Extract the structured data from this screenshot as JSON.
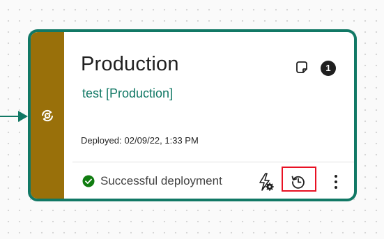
{
  "stage": {
    "title": "Production",
    "workspace": "test [Production]",
    "deployed_label": "Deployed:",
    "deployed_value": "02/09/22, 1:33 PM",
    "notification_count": "1"
  },
  "footer": {
    "status_text": "Successful deployment"
  },
  "icons": {
    "stage": "stage-swap-icon",
    "note": "note-icon",
    "status": "check-circle-icon",
    "rules": "deployment-rules-icon",
    "history": "deployment-history-icon",
    "more": "more-options-icon"
  },
  "colors": {
    "border": "#117865",
    "stage_bar": "#99700a",
    "workspace_link": "#117865",
    "success": "#107c10",
    "highlight": "#e81123",
    "badge": "#1f1f1f"
  }
}
